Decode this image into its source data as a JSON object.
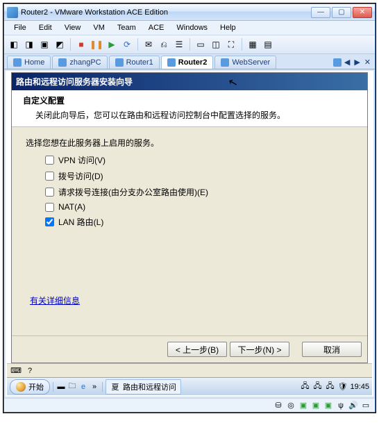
{
  "window": {
    "title": "Router2 - VMware Workstation ACE Edition"
  },
  "menu": {
    "file": "File",
    "edit": "Edit",
    "view": "View",
    "vm": "VM",
    "team": "Team",
    "ace": "ACE",
    "windows": "Windows",
    "help": "Help"
  },
  "tabs": {
    "items": [
      {
        "label": "Home"
      },
      {
        "label": "zhangPC"
      },
      {
        "label": "Router1"
      },
      {
        "label": "Router2"
      },
      {
        "label": "WebServer"
      }
    ]
  },
  "wizard": {
    "title": "路由和远程访问服务器安装向导",
    "subtitle": "自定义配置",
    "description": "关闭此向导后，您可以在路由和远程访问控制台中配置选择的服务。",
    "prompt": "选择您想在此服务器上启用的服务。",
    "options": [
      {
        "label": "VPN 访问(V)",
        "checked": false
      },
      {
        "label": "拨号访问(D)",
        "checked": false
      },
      {
        "label": "请求拨号连接(由分支办公室路由使用)(E)",
        "checked": false
      },
      {
        "label": "NAT(A)",
        "checked": false
      },
      {
        "label": "LAN 路由(L)",
        "checked": true
      }
    ],
    "link": "有关详细信息",
    "buttons": {
      "back": "< 上一步(B)",
      "next": "下一步(N) >",
      "cancel": "取消"
    }
  },
  "taskbar": {
    "start": "开始",
    "task": "路由和远程访问",
    "time": "19:45"
  }
}
